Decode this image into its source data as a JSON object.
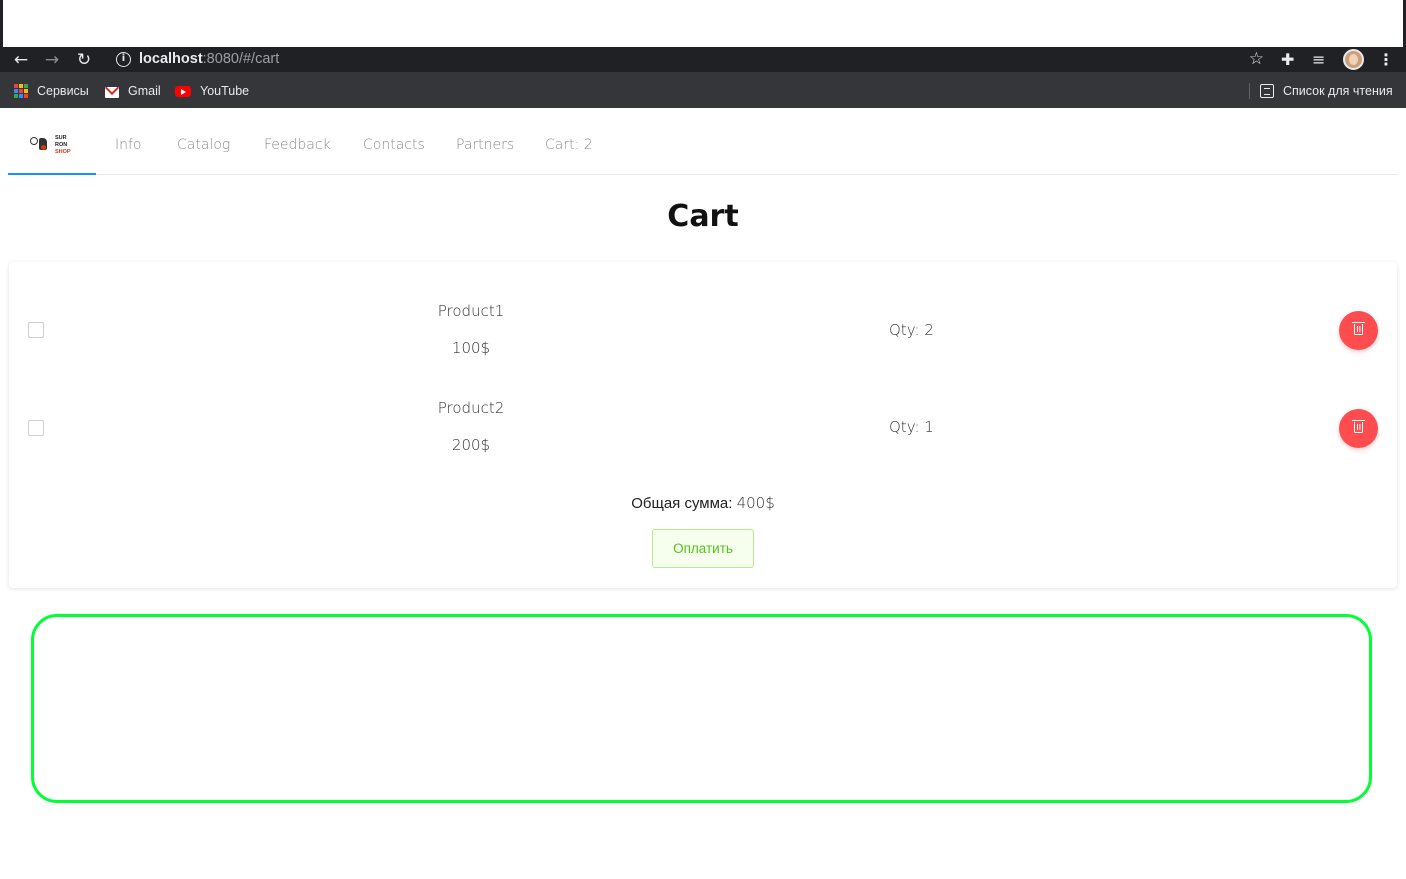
{
  "browser": {
    "url_host": "localhost",
    "url_rest": ":8080/#/cart",
    "bookmarks": [
      {
        "label": "Сервисы",
        "icon": "apps-icon"
      },
      {
        "label": "Gmail",
        "icon": "gmail-icon"
      },
      {
        "label": "YouTube",
        "icon": "youtube-icon"
      }
    ],
    "reading_list": "Список для чтения"
  },
  "nav": {
    "logo": {
      "line1": "SUR",
      "line2": "RON",
      "line3": "SHOP"
    },
    "items": [
      "Info",
      "Catalog",
      "Feedback",
      "Contacts",
      "Partners",
      "Cart: 2"
    ]
  },
  "page": {
    "title": "Cart"
  },
  "cart": {
    "items": [
      {
        "name": "Product1",
        "price": "100$",
        "qty": "Qty: 2"
      },
      {
        "name": "Product2",
        "price": "200$",
        "qty": "Qty: 1"
      }
    ],
    "total_label": "Общая сумма:",
    "total_value": "400$",
    "pay_label": "Оплатить"
  },
  "colors": {
    "accent": "#1890ff",
    "danger": "#ff4d4f",
    "success": "#52c41a",
    "outline_box": "#00ff33"
  }
}
